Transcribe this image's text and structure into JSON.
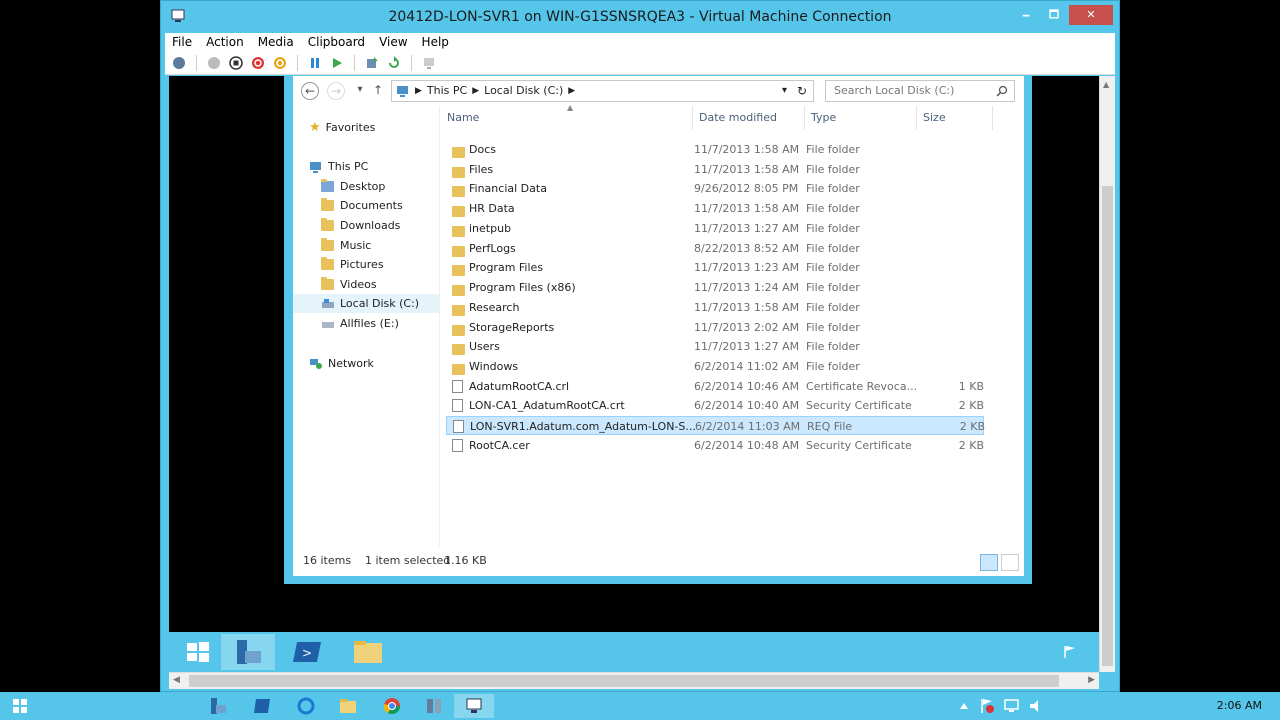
{
  "vm": {
    "title": "20412D-LON-SVR1 on WIN-G1SSNSRQEA3 - Virtual Machine Connection",
    "menu": [
      "File",
      "Action",
      "Media",
      "Clipboard",
      "View",
      "Help"
    ],
    "minimize": "🗕",
    "maximize": "🗖",
    "close": "✕"
  },
  "explorer": {
    "breadcrumb": [
      "This PC",
      "Local Disk (C:)"
    ],
    "search_placeholder": "Search Local Disk (C:)",
    "nav": {
      "favorites": "Favorites",
      "this_pc": "This PC",
      "items": [
        "Desktop",
        "Documents",
        "Downloads",
        "Music",
        "Pictures",
        "Videos",
        "Local Disk (C:)",
        "Allfiles (E:)"
      ],
      "network": "Network"
    },
    "columns": [
      "Name",
      "Date modified",
      "Type",
      "Size"
    ],
    "rows": [
      {
        "name": "Docs",
        "date": "11/7/2013 1:58 AM",
        "type": "File folder",
        "size": "",
        "kind": "folder"
      },
      {
        "name": "Files",
        "date": "11/7/2013 1:58 AM",
        "type": "File folder",
        "size": "",
        "kind": "folder"
      },
      {
        "name": "Financial Data",
        "date": "9/26/2012 8:05 PM",
        "type": "File folder",
        "size": "",
        "kind": "folder"
      },
      {
        "name": "HR Data",
        "date": "11/7/2013 1:58 AM",
        "type": "File folder",
        "size": "",
        "kind": "folder"
      },
      {
        "name": "inetpub",
        "date": "11/7/2013 1:27 AM",
        "type": "File folder",
        "size": "",
        "kind": "folder"
      },
      {
        "name": "PerfLogs",
        "date": "8/22/2013 8:52 AM",
        "type": "File folder",
        "size": "",
        "kind": "folder"
      },
      {
        "name": "Program Files",
        "date": "11/7/2013 1:23 AM",
        "type": "File folder",
        "size": "",
        "kind": "folder"
      },
      {
        "name": "Program Files (x86)",
        "date": "11/7/2013 1:24 AM",
        "type": "File folder",
        "size": "",
        "kind": "folder"
      },
      {
        "name": "Research",
        "date": "11/7/2013 1:58 AM",
        "type": "File folder",
        "size": "",
        "kind": "folder"
      },
      {
        "name": "StorageReports",
        "date": "11/7/2013 2:02 AM",
        "type": "File folder",
        "size": "",
        "kind": "folder"
      },
      {
        "name": "Users",
        "date": "11/7/2013 1:27 AM",
        "type": "File folder",
        "size": "",
        "kind": "folder"
      },
      {
        "name": "Windows",
        "date": "6/2/2014 11:02 AM",
        "type": "File folder",
        "size": "",
        "kind": "folder"
      },
      {
        "name": "AdatumRootCA.crl",
        "date": "6/2/2014 10:46 AM",
        "type": "Certificate Revoca...",
        "size": "1 KB",
        "kind": "file"
      },
      {
        "name": "LON-CA1_AdatumRootCA.crt",
        "date": "6/2/2014 10:40 AM",
        "type": "Security Certificate",
        "size": "2 KB",
        "kind": "file"
      },
      {
        "name": "LON-SVR1.Adatum.com_Adatum-LON-S...",
        "date": "6/2/2014 11:03 AM",
        "type": "REQ File",
        "size": "2 KB",
        "kind": "file"
      },
      {
        "name": "RootCA.cer",
        "date": "6/2/2014 10:48 AM",
        "type": "Security Certificate",
        "size": "2 KB",
        "kind": "file"
      }
    ],
    "selected_row": 14,
    "status": {
      "count": "16 items",
      "selection": "1 item selected",
      "size": "1.16 KB"
    }
  },
  "host": {
    "clock": "2:06 AM"
  },
  "colors": {
    "accent": "#55c6ea",
    "selection": "#cce8ff",
    "folder": "#e8c15a"
  }
}
